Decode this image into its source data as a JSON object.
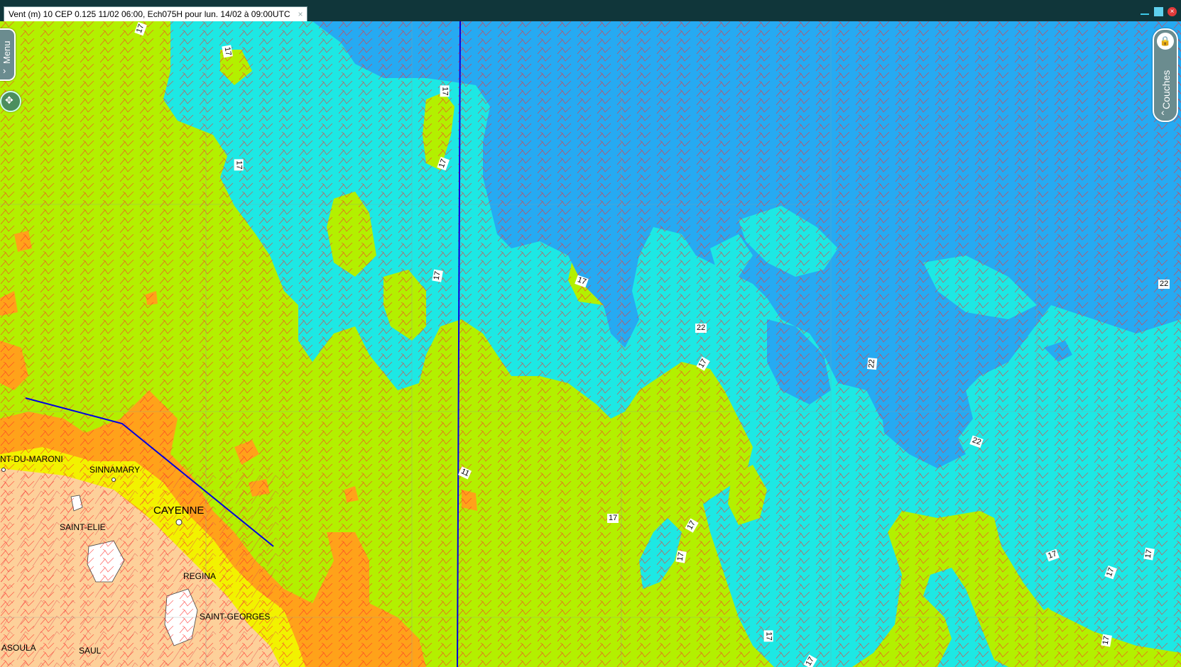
{
  "window": {
    "tab_title": "Vent  (m) 10 CEP 0.125 11/02 06:00, Ech075H pour lun. 14/02 à 09:00UTC",
    "tab_close": "×",
    "close_glyph": "×"
  },
  "controls": {
    "menu_label": "Menu",
    "menu_chevron": "›",
    "nav_glyph": "✥",
    "layers_label": "Couches",
    "layers_chevron": "‹",
    "lock_glyph": "🔒"
  },
  "isolines": [
    "17",
    "17",
    "17",
    "17",
    "17",
    "17",
    "22",
    "17",
    "22",
    "22",
    "22",
    "11",
    "17",
    "17",
    "17",
    "17",
    "17",
    "17",
    "17",
    "17",
    "17",
    "17"
  ],
  "places": [
    "NT-DU-MARONI",
    "SINNAMARY",
    "CAYENNE",
    "SAINT-ELIE",
    "REGINA",
    "SAINT-GEORGES",
    "ASOULA",
    "SAUL"
  ],
  "colors": {
    "wind_11_17": "#b3f000",
    "wind_17_22": "#1de8e4",
    "wind_22_plus": "#26aaf2",
    "wind_low": "#ffa21a",
    "land": "#fdd09a",
    "barb": "#ff2a2a",
    "track": "#0000e0"
  },
  "icons": [
    "tab-close-icon",
    "minimize-icon",
    "maximize-icon",
    "window-close-icon",
    "chevron-right-icon",
    "move-arrows-icon",
    "lock-icon",
    "chevron-left-icon"
  ]
}
